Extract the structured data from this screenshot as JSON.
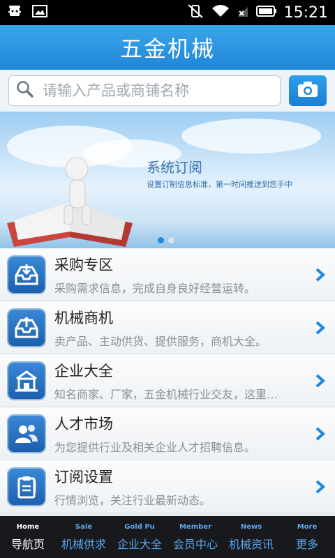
{
  "status_bar": {
    "time": "15:21"
  },
  "header": {
    "title": "五金机械"
  },
  "search": {
    "placeholder": "请输入产品或商铺名称"
  },
  "banner": {
    "title": "系统订阅",
    "subtitle": "设置订制信息标准，第一时间推送到您手中",
    "slide_count": 2,
    "active_slide": 1
  },
  "menu": [
    {
      "title": "采购专区",
      "desc": "采购需求信息，完成自身良好经营运转。",
      "icon": "inbox-download-icon"
    },
    {
      "title": "机械商机",
      "desc": "卖产品、主动供货、提供服务，商机大全。",
      "icon": "inbox-upload-icon"
    },
    {
      "title": "企业大全",
      "desc": "知名商家、厂家，五金机械行业交友，这里…",
      "icon": "building-icon"
    },
    {
      "title": "人才市场",
      "desc": "为您提供行业及相关企业人才招聘信息。",
      "icon": "people-icon"
    },
    {
      "title": "订阅设置",
      "desc": "行情浏览，关注行业最新动态。",
      "icon": "clipboard-icon"
    }
  ],
  "tabs": [
    {
      "en": "Home",
      "cn": "导航页"
    },
    {
      "en": "Sale",
      "cn": "机械供求"
    },
    {
      "en": "Gold Pu",
      "cn": "企业大全"
    },
    {
      "en": "Member",
      "cn": "会员中心"
    },
    {
      "en": "News",
      "cn": "机械资讯"
    },
    {
      "en": "More",
      "cn": "更多"
    }
  ],
  "colors": {
    "accent": "#1f86d8",
    "tab_text": "#58a7ee",
    "tab_bg": "#17191c"
  }
}
